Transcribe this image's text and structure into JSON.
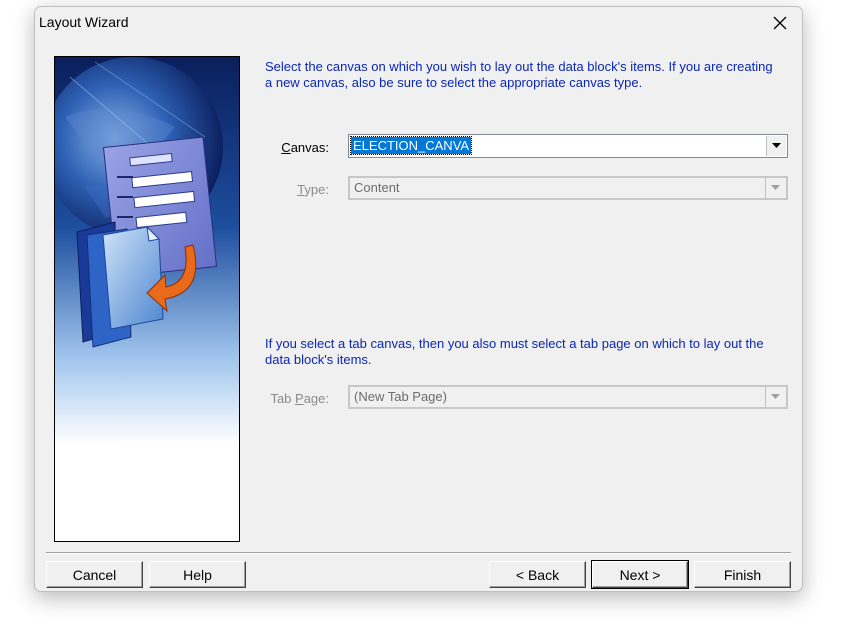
{
  "window": {
    "title": "Layout Wizard"
  },
  "instructions": {
    "canvas_line1": "Select the canvas on which you wish to lay out the data block's items. If you are creating",
    "canvas_line2": "a new canvas, also be sure to select the appropriate canvas type.",
    "tab_line1": "If you select a tab canvas, then you also must select a tab page on which to lay out the",
    "tab_line2": "data block's items."
  },
  "fields": {
    "canvas": {
      "label_pre": "",
      "label_mnemonic": "C",
      "label_post": "anvas:",
      "value": "ELECTION_CANVA",
      "enabled": true
    },
    "type": {
      "label_pre": "",
      "label_mnemonic": "T",
      "label_post": "ype:",
      "value": "Content",
      "enabled": false
    },
    "tab_page": {
      "label_pre": "Tab ",
      "label_mnemonic": "P",
      "label_post": "age:",
      "value": "(New Tab Page)",
      "enabled": false
    }
  },
  "buttons": {
    "cancel": "Cancel",
    "help": "Help",
    "back": "< Back",
    "next": "Next >",
    "finish": "Finish"
  },
  "colors": {
    "instruction_text": "#0a27b6",
    "selection": "#0078d7",
    "dialog_bg": "#f0f0f0"
  },
  "icons": {
    "close": "close-icon",
    "dropdown": "chevron-down-icon",
    "wizard_art": "layout-wizard-illustration"
  }
}
